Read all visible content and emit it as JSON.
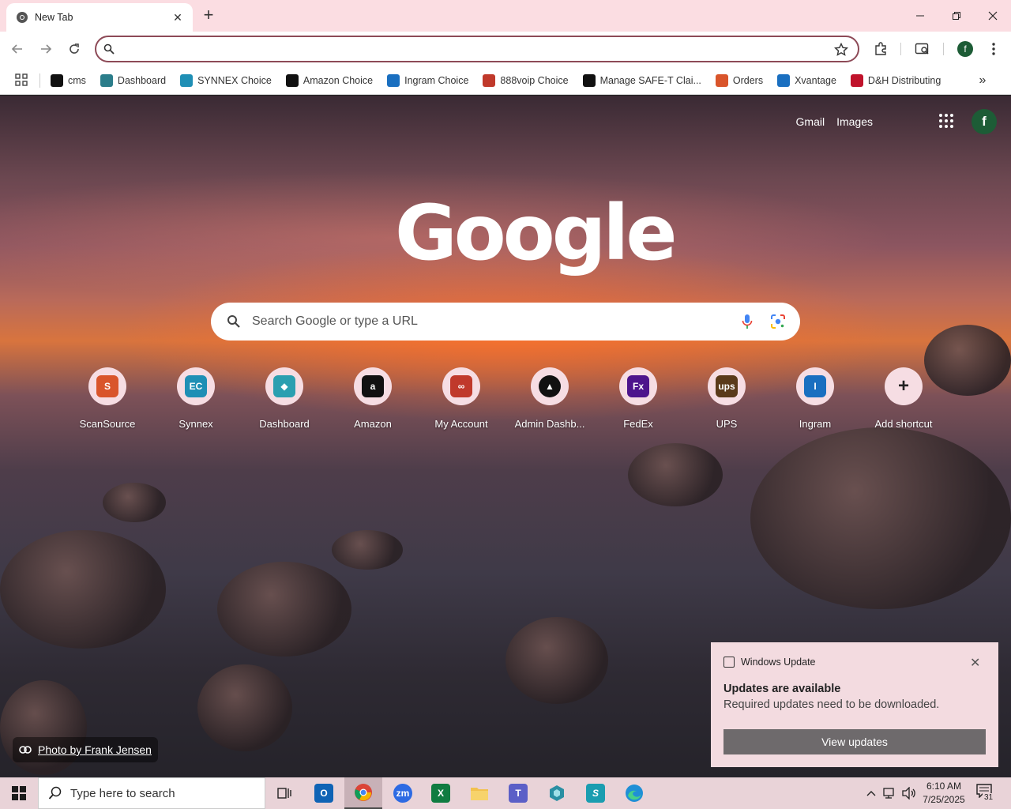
{
  "browser": {
    "tab": {
      "title": "New Tab",
      "favicon": "chrome-icon",
      "close_glyph": "✕"
    },
    "new_tab_glyph": "+",
    "window_controls": [
      "minimize-icon",
      "maximize-icon",
      "close-icon"
    ],
    "omnibox": {
      "value": "",
      "placeholder": ""
    },
    "profile_initial": "f"
  },
  "bookmarks": {
    "items": [
      {
        "label": "cms",
        "icon": "cms-icon",
        "color": "#111111"
      },
      {
        "label": "Dashboard",
        "icon": "dashboard-icon",
        "color": "#2b7d8a"
      },
      {
        "label": "SYNNEX Choice",
        "icon": "synnex-icon",
        "color": "#1f8fb5"
      },
      {
        "label": "Amazon Choice",
        "icon": "amazon-icon",
        "color": "#111111"
      },
      {
        "label": "Ingram Choice",
        "icon": "ingram-icon",
        "color": "#1a6fc0"
      },
      {
        "label": "888voip Choice",
        "icon": "888voip-icon",
        "color": "#c0392b"
      },
      {
        "label": "Manage SAFE-T Clai...",
        "icon": "amazon-icon",
        "color": "#111111"
      },
      {
        "label": "Orders",
        "icon": "scansource-icon",
        "color": "#d9552b"
      },
      {
        "label": "Xvantage",
        "icon": "ingram-icon",
        "color": "#1a6fc0"
      },
      {
        "label": "D&H Distributing",
        "icon": "dandh-icon",
        "color": "#c0132b"
      }
    ],
    "more_glyph": "»"
  },
  "ntp": {
    "links": {
      "gmail": "Gmail",
      "images": "Images"
    },
    "avatar_initial": "f",
    "logo_text": "Google",
    "search_placeholder": "Search Google or type a URL",
    "shortcuts": [
      {
        "label": "ScanSource",
        "icon": "scansource-icon"
      },
      {
        "label": "Synnex",
        "icon": "synnex-icon"
      },
      {
        "label": "Dashboard",
        "icon": "dashboard-icon"
      },
      {
        "label": "Amazon",
        "icon": "amazon-icon"
      },
      {
        "label": "My Account",
        "icon": "888voip-icon"
      },
      {
        "label": "Admin Dashb...",
        "icon": "admin-icon"
      },
      {
        "label": "FedEx",
        "icon": "fedex-icon"
      },
      {
        "label": "UPS",
        "icon": "ups-icon"
      },
      {
        "label": "Ingram",
        "icon": "ingram-icon"
      },
      {
        "label": "Add shortcut",
        "icon": "plus-icon"
      }
    ],
    "photo_credit": "Photo by Frank Jensen"
  },
  "toast": {
    "app": "Windows Update",
    "title": "Updates are available",
    "message": "Required updates need to be downloaded.",
    "button": "View updates"
  },
  "taskbar": {
    "search_placeholder": "Type here to search",
    "apps": [
      "task-view-icon",
      "outlook-icon",
      "chrome-icon",
      "zoom-icon",
      "excel-icon",
      "file-explorer-icon",
      "teams-icon",
      "app-icon",
      "scansource-app-icon",
      "edge-icon"
    ],
    "zoom_label": "zm",
    "excel_label": "X",
    "time": "6:10 AM",
    "date": "7/25/2025",
    "notification_count": "31"
  }
}
